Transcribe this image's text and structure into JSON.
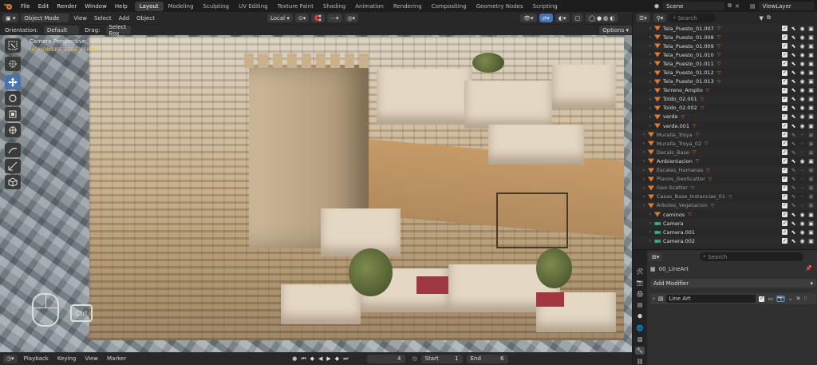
{
  "menu": [
    "File",
    "Edit",
    "Render",
    "Window",
    "Help"
  ],
  "workspace_tabs": [
    "Layout",
    "Modeling",
    "Sculpting",
    "UV Editing",
    "Texture Paint",
    "Shading",
    "Animation",
    "Rendering",
    "Compositing",
    "Geometry Nodes",
    "Scripting"
  ],
  "active_tab": "Layout",
  "scene": {
    "name": "Scene"
  },
  "view_layer": {
    "name": "ViewLayer"
  },
  "viewport_header": {
    "mode": "Object Mode",
    "view": "View",
    "select": "Select",
    "add": "Add",
    "object": "Object",
    "transform_orientation": "Local",
    "options": "Options"
  },
  "tool_header": {
    "orientation_label": "Orientation:",
    "orientation_value": "Default",
    "drag_label": "Drag:",
    "drag_value": "Select Box"
  },
  "viewport": {
    "camera_label": "Camera Perspective",
    "object_label": "(4) HOMBRE_BEBE_PERRO.__________",
    "ctrl_key": "Ctrl"
  },
  "timeline": {
    "playback": "Playback",
    "keying": "Keying",
    "view": "View",
    "marker": "Marker",
    "current_frame": "4",
    "start_label": "Start",
    "start": "1",
    "end_label": "End",
    "end": "6"
  },
  "outliner": {
    "search_placeholder": "Search",
    "rows": [
      {
        "name": "Tela_Puesto_01.007",
        "kind": "mesh",
        "dim": false
      },
      {
        "name": "Tela_Puesto_01.008",
        "kind": "mesh",
        "dim": false
      },
      {
        "name": "Tela_Puesto_01.009",
        "kind": "mesh",
        "dim": false
      },
      {
        "name": "Tela_Puesto_01.010",
        "kind": "mesh",
        "dim": false
      },
      {
        "name": "Tela_Puesto_01.011",
        "kind": "mesh",
        "dim": false
      },
      {
        "name": "Tela_Puesto_01.012",
        "kind": "mesh",
        "dim": false
      },
      {
        "name": "Tela_Puesto_01.013",
        "kind": "mesh",
        "dim": false
      },
      {
        "name": "Terreno_Amplio",
        "kind": "mesh",
        "dim": false
      },
      {
        "name": "Toldo_02.001",
        "kind": "mesh",
        "dim": false
      },
      {
        "name": "Toldo_02.002",
        "kind": "mesh",
        "dim": false
      },
      {
        "name": "verde",
        "kind": "mesh",
        "dim": false
      },
      {
        "name": "verde.001",
        "kind": "mesh",
        "dim": false
      },
      {
        "name": "Muralla_Troya",
        "kind": "mesh",
        "dim": true
      },
      {
        "name": "Muralla_Troya_02",
        "kind": "mesh",
        "dim": true
      },
      {
        "name": "Decals_Base",
        "kind": "mesh",
        "dim": true
      },
      {
        "name": "Ambientacion",
        "kind": "mesh",
        "dim": false
      },
      {
        "name": "Escalas_Humanas",
        "kind": "mesh",
        "dim": true
      },
      {
        "name": "Planos_GeoScatter",
        "kind": "mesh",
        "dim": true
      },
      {
        "name": "Geo-Scatter",
        "kind": "mesh",
        "dim": true
      },
      {
        "name": "Casas_Base_Instancias_01",
        "kind": "mesh",
        "dim": true
      },
      {
        "name": "Arboles_Vegetacion",
        "kind": "mesh",
        "dim": true
      },
      {
        "name": "caminos",
        "kind": "mesh",
        "dim": false
      },
      {
        "name": "Camera",
        "kind": "camera",
        "dim": false
      },
      {
        "name": "Camera.001",
        "kind": "camera",
        "dim": false
      },
      {
        "name": "Camera.002",
        "kind": "camera",
        "dim": false
      }
    ]
  },
  "properties": {
    "search_placeholder": "Search",
    "object_name": "00_LineArt",
    "add_modifier": "Add Modifier",
    "modifier_name": "Line Art"
  },
  "colors": {
    "accent": "#4772b3",
    "active_tab_bg": "#3d3d3d",
    "outliner_bg": "#282828",
    "mesh_icon": "#e07a2d",
    "camera_icon": "#2fae7f",
    "object_label": "#f0c23a"
  }
}
